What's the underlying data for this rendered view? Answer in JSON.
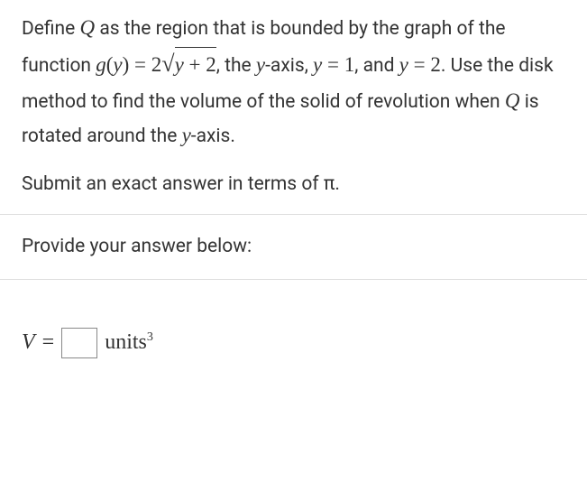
{
  "problem": {
    "prefix": "Define ",
    "Q": "Q",
    "seg1": " as the region that is bounded by the graph of the function ",
    "g_open": "g",
    "paren_open": "(",
    "y_var": "y",
    "paren_close": ")",
    "eq": " = ",
    "two": "2",
    "radicand_y": "y",
    "radicand_plus": " + ",
    "radicand_two": "2",
    "seg2": ", the ",
    "y_axis_y": "y",
    "seg2b": "-axis, ",
    "y1_y": "y",
    "y1_eq": " = ",
    "y1_val": "1",
    "seg3": ", and ",
    "y2_y": "y",
    "y2_eq": " = ",
    "y2_val": "2",
    "seg4": ". Use the disk method to find the volume of the solid of revolution when ",
    "Q2": "Q",
    "seg5": " is rotated around the ",
    "y_axis2_y": "y",
    "seg6": "-axis."
  },
  "instruction": {
    "text": "Submit an exact answer in terms of ",
    "pi": "π",
    "period": "."
  },
  "prompt": "Provide your answer below:",
  "answer": {
    "V": "V",
    "eq": "=",
    "input_value": "",
    "units": "units",
    "exp": "3"
  }
}
